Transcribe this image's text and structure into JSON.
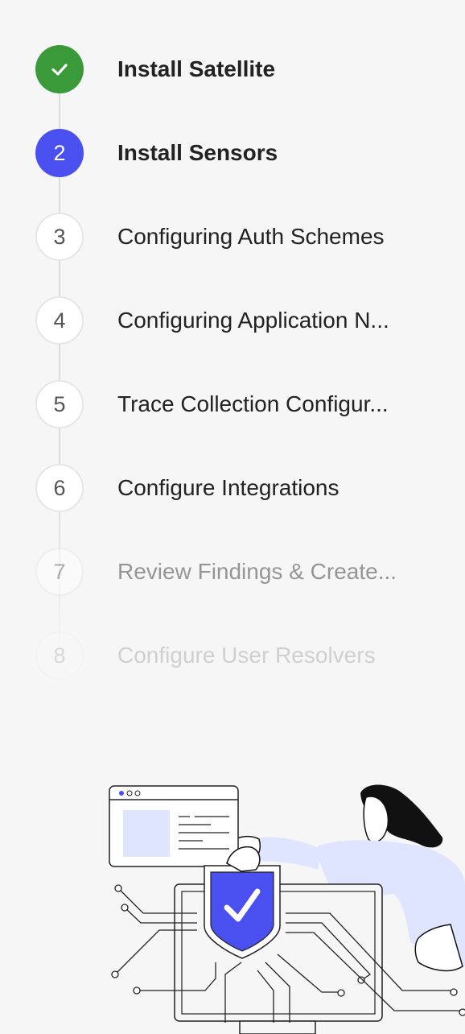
{
  "steps": [
    {
      "number": "",
      "label": "Install Satellite",
      "state": "done"
    },
    {
      "number": "2",
      "label": "Install Sensors",
      "state": "active"
    },
    {
      "number": "3",
      "label": "Configuring Auth Schemes",
      "state": "todo"
    },
    {
      "number": "4",
      "label": "Configuring Application N...",
      "state": "todo"
    },
    {
      "number": "5",
      "label": "Trace Collection Configur...",
      "state": "todo"
    },
    {
      "number": "6",
      "label": "Configure Integrations",
      "state": "todo"
    },
    {
      "number": "7",
      "label": "Review Findings & Create...",
      "state": "todo"
    },
    {
      "number": "8",
      "label": "Configure User Resolvers",
      "state": "todo"
    }
  ],
  "colors": {
    "done": "#3a9a3a",
    "active": "#4a4ff0",
    "background": "#f6f6f6",
    "illustration_accent": "#dfe5ff"
  }
}
